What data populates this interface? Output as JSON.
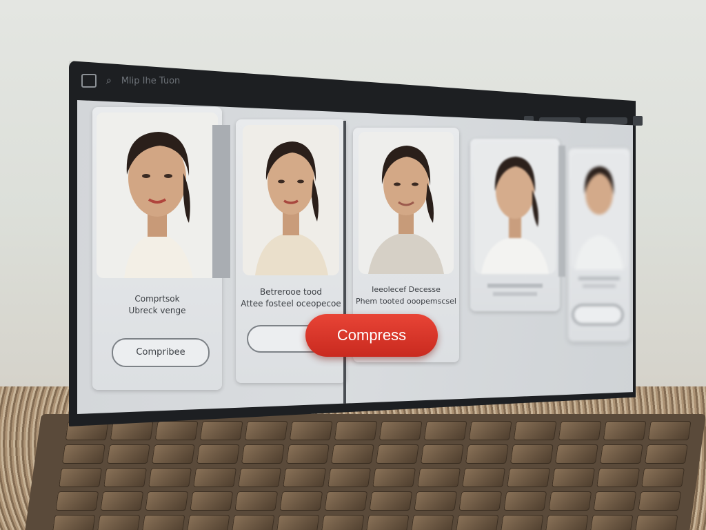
{
  "topbar": {
    "menu_icon": "grid-icon",
    "search_icon": "search-icon",
    "title": "Mlip Ihe Tuon"
  },
  "cards": [
    {
      "caption_lines": [
        "Comprtsok",
        "Ubreck venge"
      ],
      "button_label": "Compribee"
    },
    {
      "caption_lines": [
        "Betrerooe tood",
        "Attee fosteel oceopecoe"
      ],
      "button_label": ""
    },
    {
      "caption_lines": [
        "Ieeolecef Decesse",
        "Phem tooted ooopemscsel"
      ],
      "button_label": ""
    },
    {
      "caption_lines": [
        "",
        ""
      ],
      "button_label": ""
    },
    {
      "caption_lines": [
        "",
        ""
      ],
      "button_label": ""
    }
  ],
  "primary_action": {
    "label": "Compress",
    "color": "#dc3a2c"
  },
  "colors": {
    "bezel": "#1d1f22",
    "card_bg": "#e4e6e8",
    "accent": "#dc3a2c"
  }
}
